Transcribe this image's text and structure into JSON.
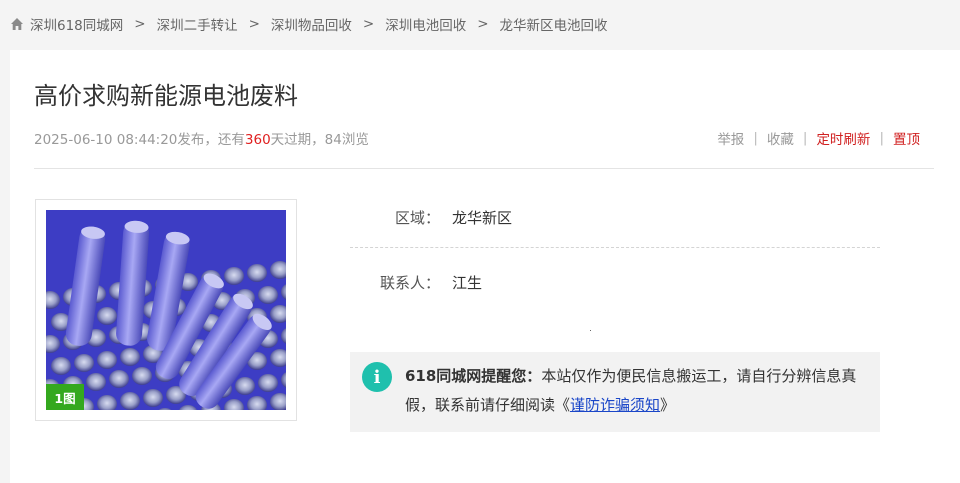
{
  "breadcrumb": [
    {
      "label": "深圳618同城网"
    },
    {
      "label": "深圳二手转让"
    },
    {
      "label": "深圳物品回收"
    },
    {
      "label": "深圳电池回收"
    },
    {
      "label": "龙华新区电池回收"
    }
  ],
  "breadcrumb_sep": ">",
  "listing": {
    "title": "高价求购新能源电池废料",
    "date": "2025-06-10 08:44:20",
    "published_text": "发布，还有",
    "days_left": "360",
    "expire_text": "天过期，",
    "views": "84",
    "views_text": "浏览"
  },
  "actions": {
    "report": "举报",
    "favorite": "收藏",
    "timed_refresh": "定时刷新",
    "pin_top": "置顶",
    "separator": "|"
  },
  "photo": {
    "count_badge": "1图"
  },
  "details": {
    "region_label": "区域：",
    "region_value": "龙华新区",
    "contact_label": "联系人：",
    "contact_value": "江生"
  },
  "notice": {
    "icon": "i",
    "brand": "618同城网提醒您：",
    "text": "本站仅作为便民信息搬运工，请自行分辨信息真假，联系前请仔细阅读",
    "open_quote": "《",
    "link": "谨防诈骗须知",
    "close_quote": "》"
  },
  "colors": {
    "accent_red": "#e02020",
    "badge_green": "#34a81e",
    "info_teal": "#1fc0ad",
    "link_blue": "#1a46c8"
  }
}
